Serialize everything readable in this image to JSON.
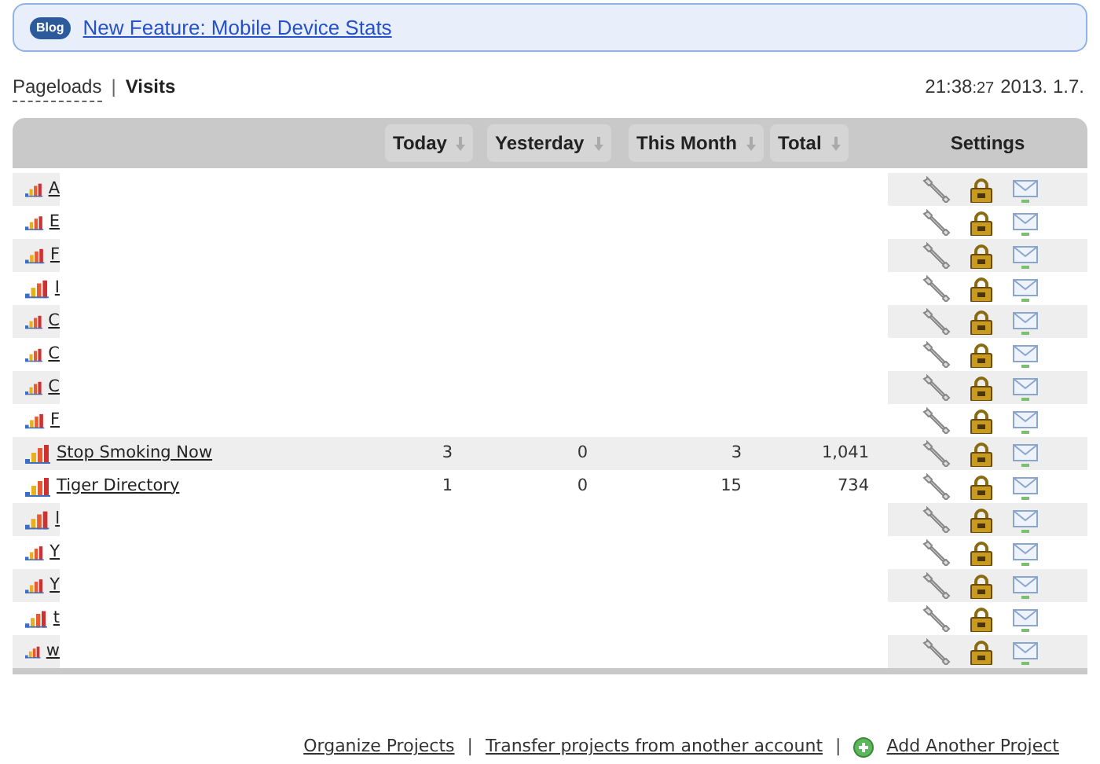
{
  "banner": {
    "badge": "Blog",
    "link": "New Feature: Mobile Device Stats"
  },
  "view_tab_separator": "|",
  "view_tabs": [
    {
      "label": "Pageloads",
      "selected": false
    },
    {
      "label": "Visits",
      "selected": true
    }
  ],
  "clock": {
    "time": "21:38",
    "seconds": ":27",
    "date": "2013. 1.7."
  },
  "table": {
    "columns": [
      {
        "label": "Today",
        "sortable": true
      },
      {
        "label": "Yesterday",
        "sortable": true
      },
      {
        "label": "This Month",
        "sortable": true
      },
      {
        "label": "Total",
        "sortable": true
      },
      {
        "label": "Settings",
        "sortable": false
      }
    ],
    "rows": [
      {
        "name": "A",
        "redacted": true
      },
      {
        "name": "E",
        "redacted": true
      },
      {
        "name": "F",
        "redacted": true
      },
      {
        "name": "I",
        "redacted": true
      },
      {
        "name": "C",
        "redacted": true
      },
      {
        "name": "C",
        "redacted": true
      },
      {
        "name": "C",
        "redacted": true
      },
      {
        "name": "F",
        "redacted": true
      },
      {
        "name": "Stop Smoking Now",
        "redacted": false,
        "today": "3",
        "yesterday": "0",
        "this_month": "3",
        "total": "1,041"
      },
      {
        "name": "Tiger Directory",
        "redacted": false,
        "today": "1",
        "yesterday": "0",
        "this_month": "15",
        "total": "734"
      },
      {
        "name": "l",
        "redacted": true
      },
      {
        "name": "Y",
        "redacted": true
      },
      {
        "name": "Y",
        "redacted": true
      },
      {
        "name": "t",
        "redacted": true
      },
      {
        "name": "w",
        "redacted": true
      }
    ]
  },
  "footer_separators": [
    "|",
    "|"
  ],
  "footer_links": [
    "Organize Projects",
    "Transfer projects from another account",
    "Add Another Project"
  ]
}
